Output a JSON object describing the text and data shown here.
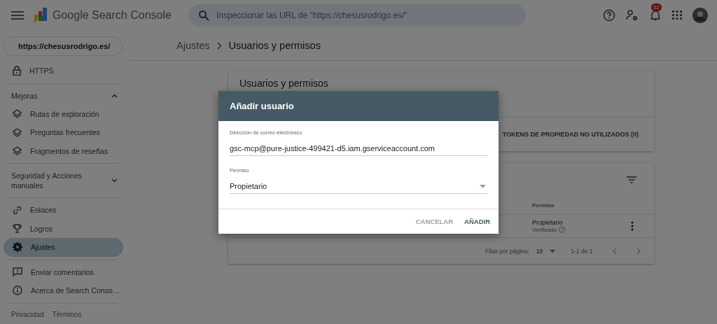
{
  "header": {
    "app_title": "Google Search Console",
    "search": {
      "placeholder": "Inspeccionar las URL de \"https://chesusrodrigo.es/\""
    },
    "notification_count": "52"
  },
  "property": {
    "label": "https://chesusrodrigo.es/"
  },
  "sidebar": {
    "groups": [
      {
        "items": [
          {
            "label": "HTTPS",
            "selected": false
          }
        ]
      },
      {
        "heading": "Mejoras",
        "expanded": true,
        "items": [
          {
            "label": "Rutas de exploración",
            "selected": false
          },
          {
            "label": "Preguntas frecuentes",
            "selected": false
          },
          {
            "label": "Fragmentos de reseñas",
            "selected": false
          }
        ]
      },
      {
        "heading": "Seguridad y Acciones manuales",
        "expanded": false
      },
      {
        "items": [
          {
            "label": "Enlaces",
            "selected": false
          },
          {
            "label": "Logros",
            "selected": false
          },
          {
            "label": "Ajustes",
            "selected": true
          }
        ]
      },
      {
        "items": [
          {
            "label": "Enviar comentarios",
            "selected": false
          },
          {
            "label": "Acerca de Search Conso…",
            "selected": false
          }
        ]
      }
    ],
    "footer_links": [
      "Privacidad",
      "Términos"
    ]
  },
  "breadcrumb": [
    "Ajustes",
    "Usuarios y permisos"
  ],
  "users_card": {
    "title": "Usuarios y permisos",
    "tokens_link": "TOKENS DE PROPIEDAD NO UTILIZADOS (0)"
  },
  "table": {
    "columns": [
      "Permiso"
    ],
    "rows": [
      {
        "permission": "Propietario",
        "status": "Verificado"
      }
    ],
    "pagination": {
      "rows_per_page_label": "Filas por página:",
      "rows_per_page": "10",
      "range": "1-1 de 1"
    }
  },
  "dialog": {
    "title": "Añadir usuario",
    "email_field": {
      "label": "Dirección de correo electrónico",
      "value": "gsc-mcp@pure-justice-499421-d5.iam.gserviceaccount.com"
    },
    "permission_field": {
      "label": "Permiso",
      "value": "Propietario"
    },
    "buttons": [
      {
        "label": "CANCELAR",
        "kind": "secondary"
      },
      {
        "label": "AÑADIR",
        "kind": "primary"
      }
    ]
  }
}
